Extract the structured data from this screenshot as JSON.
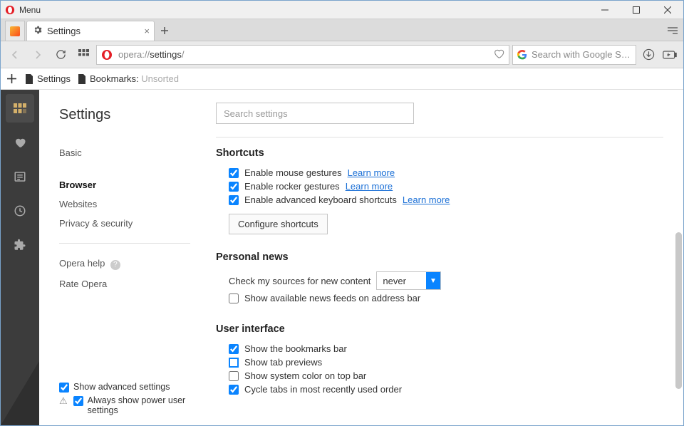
{
  "window": {
    "menu_label": "Menu"
  },
  "tabs": {
    "active_label": "Settings"
  },
  "address": {
    "url_prefix": "opera://",
    "url_bold": "settings",
    "url_suffix": "/",
    "search_placeholder": "Search with Google S…"
  },
  "bookmarks_bar": {
    "item1": "Settings",
    "item2_prefix": "Bookmarks: ",
    "item2_faded": "Unsorted"
  },
  "sidebar": {
    "title": "Settings",
    "items": [
      "Basic",
      "Browser",
      "Websites",
      "Privacy & security"
    ],
    "help": "Opera help",
    "rate": "Rate Opera",
    "show_advanced": "Show advanced settings",
    "power_user": "Always show power user settings"
  },
  "main": {
    "search_placeholder": "Search settings",
    "shortcuts": {
      "title": "Shortcuts",
      "opts": [
        "Enable mouse gestures",
        "Enable rocker gestures",
        "Enable advanced keyboard shortcuts"
      ],
      "learn": "Learn more",
      "button": "Configure shortcuts"
    },
    "news": {
      "title": "Personal news",
      "label": "Check my sources for new content",
      "value": "never",
      "feeds": "Show available news feeds on address bar"
    },
    "ui": {
      "title": "User interface",
      "opts": [
        "Show the bookmarks bar",
        "Show tab previews",
        "Show system color on top bar",
        "Cycle tabs in most recently used order"
      ]
    }
  }
}
